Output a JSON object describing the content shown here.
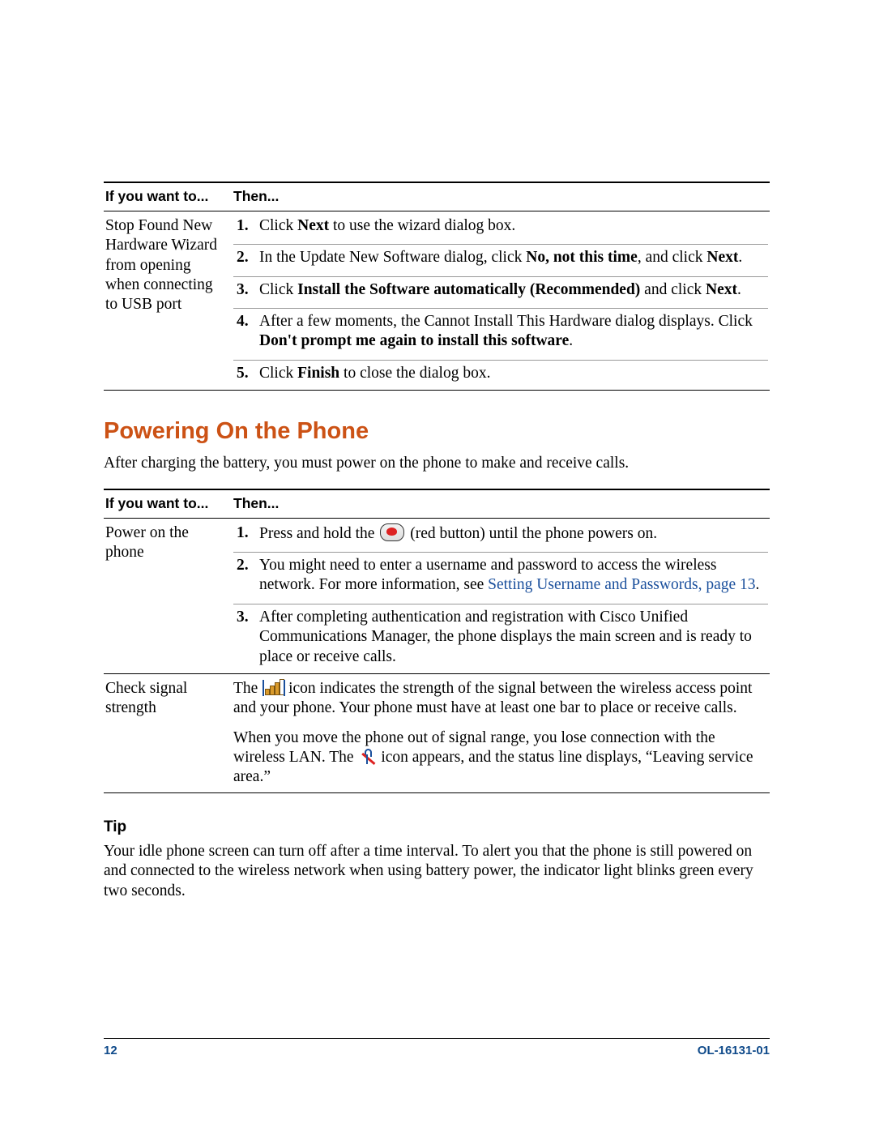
{
  "colors": {
    "accent_orange": "#cc5215",
    "link_blue": "#1a4f9c",
    "footer_blue": "#0f4a8a"
  },
  "table1": {
    "headers": {
      "left": "If you want to...",
      "right": "Then..."
    },
    "row1": {
      "leftcol": "Stop Found New Hardware Wizard from opening when connecting to USB port",
      "step1": {
        "n": "1.",
        "pre": "Click ",
        "b1": "Next",
        "post": " to use the wizard dialog box."
      },
      "step2": {
        "n": "2.",
        "pre": "In the Update New Software dialog, click ",
        "b1": "No, not this time",
        "mid": ", and click ",
        "b2": "Next",
        "post": "."
      },
      "step3": {
        "n": "3.",
        "pre": "Click ",
        "b1": "Install the Software automatically (Recommended)",
        "mid": " and click ",
        "b2": "Next",
        "post": "."
      },
      "step4": {
        "n": "4.",
        "l1": "After a few moments, the Cannot Install This Hardware dialog displays. Click ",
        "b1": "Don't prompt me again to install this software",
        "post": "."
      },
      "step5": {
        "n": "5.",
        "pre": "Click ",
        "b1": "Finish",
        "post": " to close the dialog box."
      }
    }
  },
  "section_heading": "Powering On the Phone",
  "intro": "After charging the battery, you must power on the phone to make and receive calls.",
  "table2": {
    "headers": {
      "left": "If you want to...",
      "right": "Then..."
    },
    "row1": {
      "leftcol": "Power on the phone",
      "step1": {
        "n": "1.",
        "pre": "Press and hold the ",
        "post": " (red button) until the phone powers on."
      },
      "step2": {
        "n": "2.",
        "text": "You might need to enter a username and password to access the wireless network. For more information, see ",
        "link": "Setting Username and Passwords, page 13",
        "post": "."
      },
      "step3": {
        "n": "3.",
        "text": "After completing authentication and registration with Cisco Unified Communications Manager, the phone displays the main screen and is ready to place or receive calls."
      }
    },
    "row2": {
      "leftcol": "Check signal strength",
      "p1a": "The ",
      "p1b": " icon indicates the strength of the signal between the wireless access point and your phone. Your phone must have at least one bar to place or receive calls.",
      "p2a": "When you move the phone out of signal range, you lose connection with the wireless LAN. The ",
      "p2b": " icon appears, and the status line displays, “Leaving service area.”"
    }
  },
  "tip": {
    "heading": "Tip",
    "body": "Your idle phone screen can turn off after a time interval. To alert you that the phone is still powered on and connected to the wireless network when using battery power, the indicator light blinks green every two seconds."
  },
  "footer": {
    "page": "12",
    "docid": "OL-16131-01"
  }
}
